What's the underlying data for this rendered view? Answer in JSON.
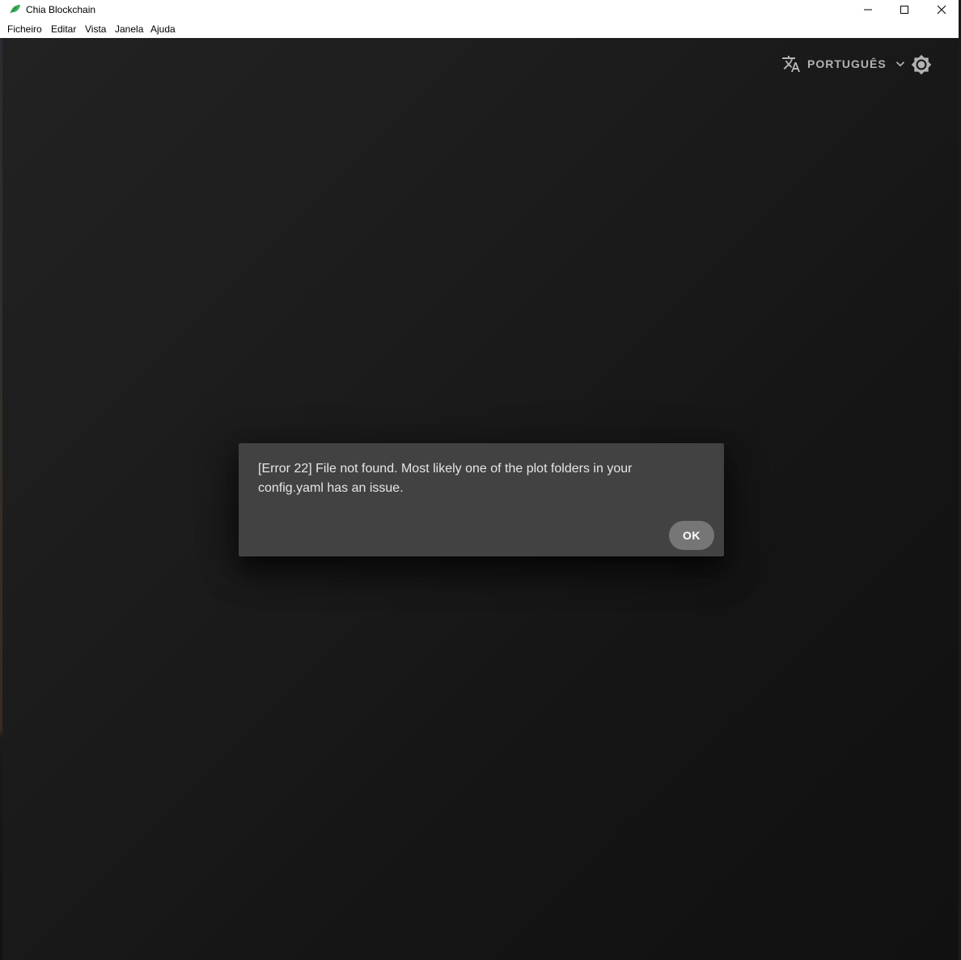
{
  "window": {
    "title": "Chia Blockchain"
  },
  "menu": {
    "items": [
      "Ficheiro",
      "Editar",
      "Vista",
      "Janela",
      "Ajuda"
    ]
  },
  "toolbar": {
    "language_label": "PORTUGUÊS",
    "language_icon": "translate-icon",
    "dropdown_icon": "chevron-down-icon",
    "theme_icon": "brightness-icon"
  },
  "dialog": {
    "message": "[Error 22] File not found. Most likely one of the plot folders in your config.yaml has an issue.",
    "ok_label": "OK"
  },
  "colors": {
    "brand_green": "#3aac59",
    "dialog_bg": "#424242",
    "ok_button_bg": "#767676"
  }
}
